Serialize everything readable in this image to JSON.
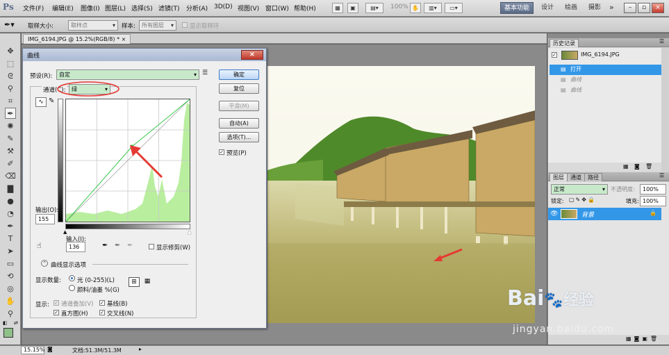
{
  "app": {
    "logo": "Ps"
  },
  "menu": [
    "文件(F)",
    "编辑(E)",
    "图像(I)",
    "图层(L)",
    "选择(S)",
    "滤镜(T)",
    "分析(A)",
    "3D(D)",
    "视图(V)",
    "窗口(W)",
    "帮助(H)"
  ],
  "topbar": {
    "zoom": "100%",
    "workspaces": [
      "基本功能",
      "设计",
      "绘画",
      "摄影"
    ],
    "more": "»"
  },
  "options": {
    "sample_size_label": "取样大小:",
    "sample_size_value": "取样点",
    "sample_label": "样本:",
    "sample_value": "所有图层",
    "show_ring": "显示取样环"
  },
  "document": {
    "tab_title": "IMG_6194.JPG @ 15.2%(RGB/8) *",
    "close": "×"
  },
  "status": {
    "zoom": "15.15%",
    "doc_info": "文档:51.3M/51.3M"
  },
  "dialog": {
    "title": "曲线",
    "preset_label": "预设(R):",
    "preset_value": "自定",
    "channel_label": "通道(C):",
    "channel_value": "绿",
    "buttons": {
      "ok": "确定",
      "reset": "复位",
      "smooth": "平滑(M)",
      "auto": "自动(A)",
      "options": "选项(T)..."
    },
    "preview_label": "预览(P)",
    "output_label": "输出(O):",
    "output_value": "155",
    "input_label": "输入(I):",
    "input_value": "136",
    "show_clipping": "显示修剪(W)",
    "curve_options_title": "曲线显示选项",
    "show_amount_label": "显示数量:",
    "light_option": "光 (0-255)(L)",
    "pigment_option": "颜料/油墨 %(G)",
    "show_label": "显示:",
    "channel_overlay": "通道叠加(V)",
    "baseline": "基线(B)",
    "histogram": "直方图(H)",
    "intersection": "交叉线(N)"
  },
  "history": {
    "tabs": [
      "历史记录"
    ],
    "snapshot": "IMG_6194.JPG",
    "items": [
      "打开",
      "曲线",
      "曲线"
    ]
  },
  "layers": {
    "tabs": [
      "图层",
      "通道",
      "路径"
    ],
    "blend_mode": "正常",
    "opacity_label": "不透明度:",
    "opacity_value": "100%",
    "lock_label": "锁定:",
    "fill_label": "填充:",
    "fill_value": "100%",
    "layer_name": "背景"
  },
  "watermark": {
    "brand": "Bai",
    "brand2": "经验",
    "url": "jingyan.baidu.com"
  },
  "colors": {
    "accent": "#3397e8",
    "curve": "#36c84a",
    "histogram": "#b9ee9f",
    "annotation": "#e53a33"
  }
}
